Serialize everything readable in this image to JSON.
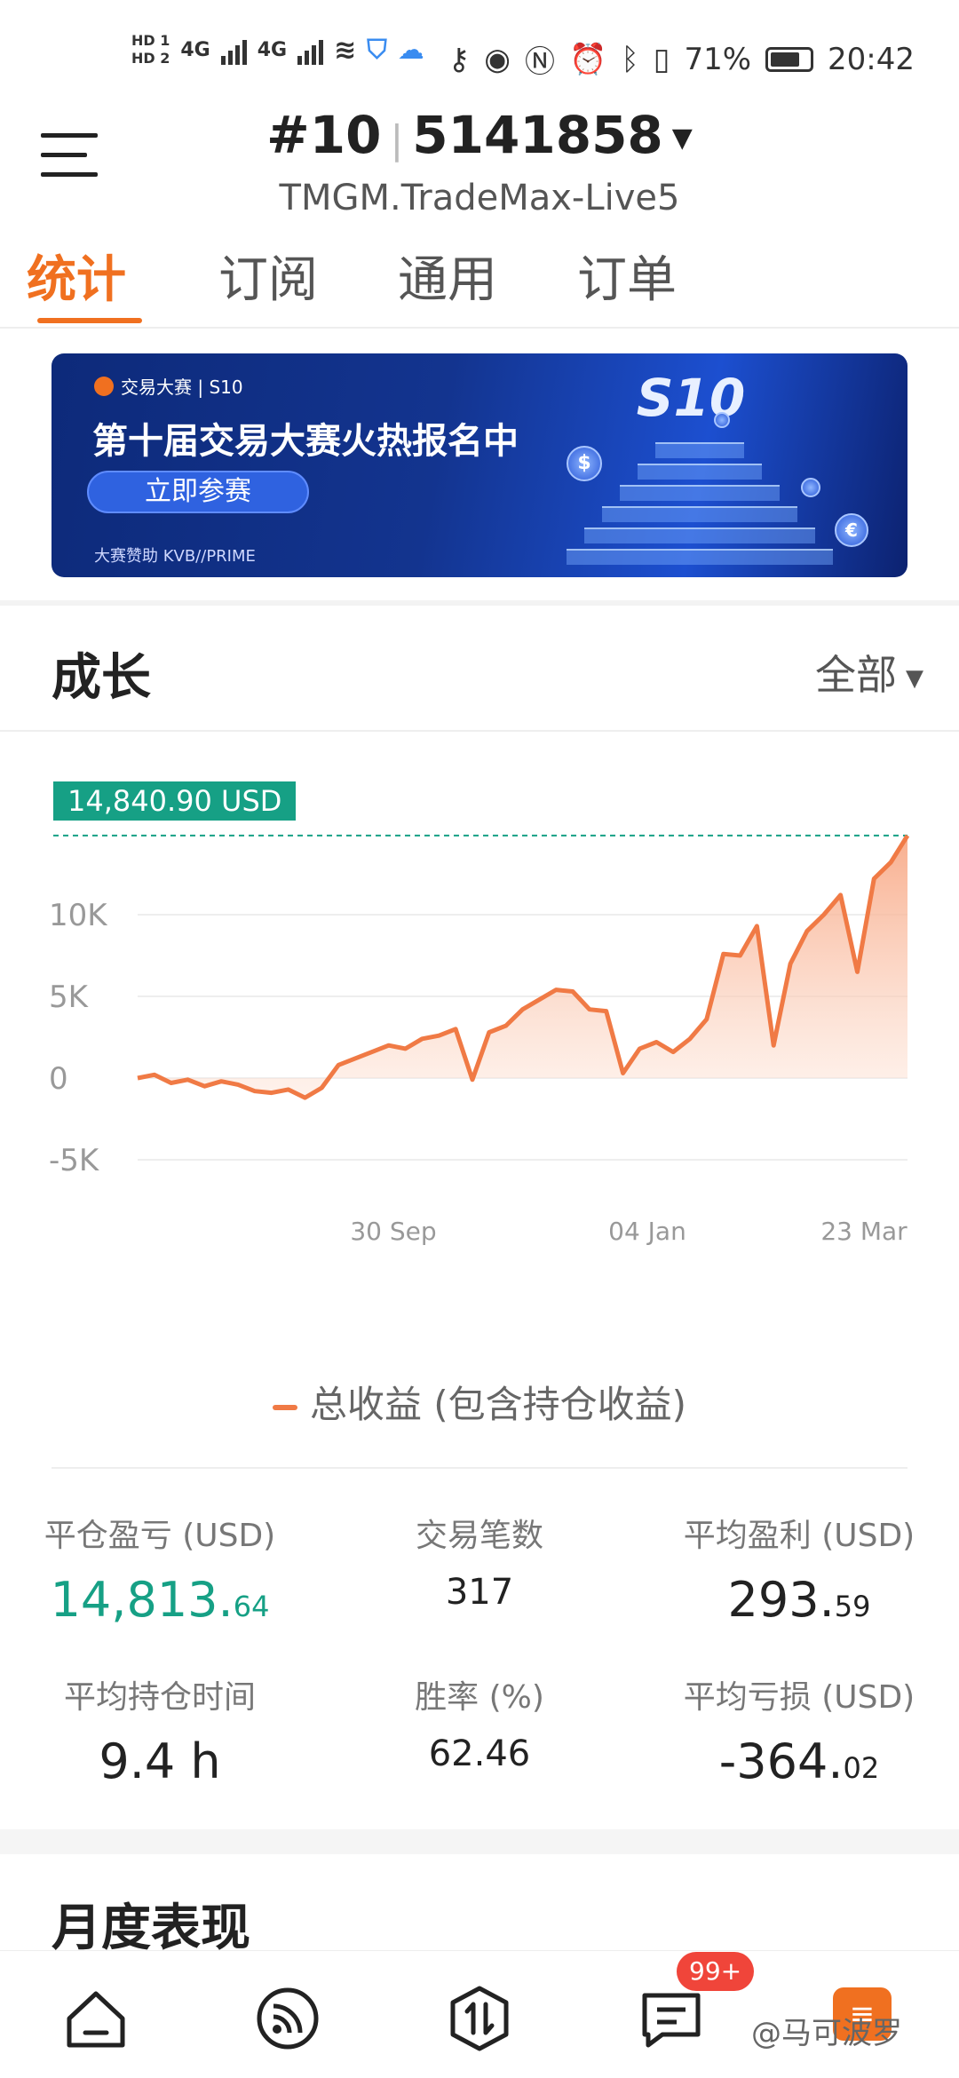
{
  "status_bar": {
    "sim1": "HD 1",
    "sim2": "HD 2",
    "net1": "4G",
    "net2": "4G",
    "battery": "71%",
    "time": "20:42",
    "icons": [
      "key-icon",
      "eye-icon",
      "nfc-icon",
      "alarm-icon",
      "bluetooth-icon",
      "vibrate-icon"
    ]
  },
  "header": {
    "account_rank": "#10",
    "account_id": "5141858",
    "server": "TMGM.TradeMax-Live5"
  },
  "tabs": [
    {
      "label": "统计",
      "active": true
    },
    {
      "label": "订阅",
      "active": false
    },
    {
      "label": "通用",
      "active": false
    },
    {
      "label": "订单",
      "active": false
    }
  ],
  "banner": {
    "brand": "交易大赛 | S10",
    "title": "第十届交易大赛火热报名中",
    "button": "立即参赛",
    "sponsor": "大赛赞助 KVB//PRIME",
    "badge": "S10"
  },
  "growth": {
    "title": "成长",
    "filter": "全部",
    "peak_label": "14,840.90 USD",
    "legend": "总收益 (包含持仓收益)"
  },
  "chart_data": {
    "type": "area",
    "series": [
      {
        "name": "总收益 (包含持仓收益)",
        "color": "#f07a45",
        "y": [
          0,
          200,
          -300,
          -100,
          -500,
          -200,
          -400,
          -800,
          -900,
          -700,
          -1200,
          -600,
          800,
          1200,
          1600,
          2000,
          1800,
          2400,
          2600,
          3000,
          -100,
          2800,
          3200,
          4200,
          4800,
          5400,
          5300,
          4200,
          4100,
          300,
          1800,
          2200,
          1600,
          2400,
          3600,
          7600,
          7500,
          9300,
          2000,
          7000,
          9000,
          10000,
          11200,
          6500,
          12200,
          13200,
          14840.9
        ]
      }
    ],
    "x_tick_labels": [
      "30 Sep",
      "04 Jan",
      "23 Mar"
    ],
    "y_tick_labels": [
      "10K",
      "5K",
      "0",
      "-5K"
    ],
    "ylim": [
      -5000,
      15000
    ],
    "grid": true,
    "peak_value": 14840.9
  },
  "stats": [
    {
      "label": "平仓盈亏 (USD)",
      "int": "14,813.",
      "dec": "64",
      "style": "green"
    },
    {
      "label": "交易笔数",
      "int": "317",
      "dec": "",
      "style": "small"
    },
    {
      "label": "平均盈利 (USD)",
      "int": "293.",
      "dec": "59",
      "style": "normal"
    },
    {
      "label": "平均持仓时间",
      "int": "9.4 h",
      "dec": "",
      "style": "normal"
    },
    {
      "label": "胜率 (%)",
      "int": "62.46",
      "dec": "",
      "style": "small"
    },
    {
      "label": "平均亏损 (USD)",
      "int": "-364.",
      "dec": "02",
      "style": "normal"
    }
  ],
  "monthly": {
    "title": "月度表现"
  },
  "bottom_nav": {
    "items": [
      "home-icon",
      "feed-icon",
      "trade-icon",
      "messages-icon",
      "profile-icon"
    ],
    "badge": "99+",
    "watermark": "@马可波罗"
  },
  "colors": {
    "accent": "#f07020",
    "green": "#16a085",
    "line": "#f07a45"
  }
}
